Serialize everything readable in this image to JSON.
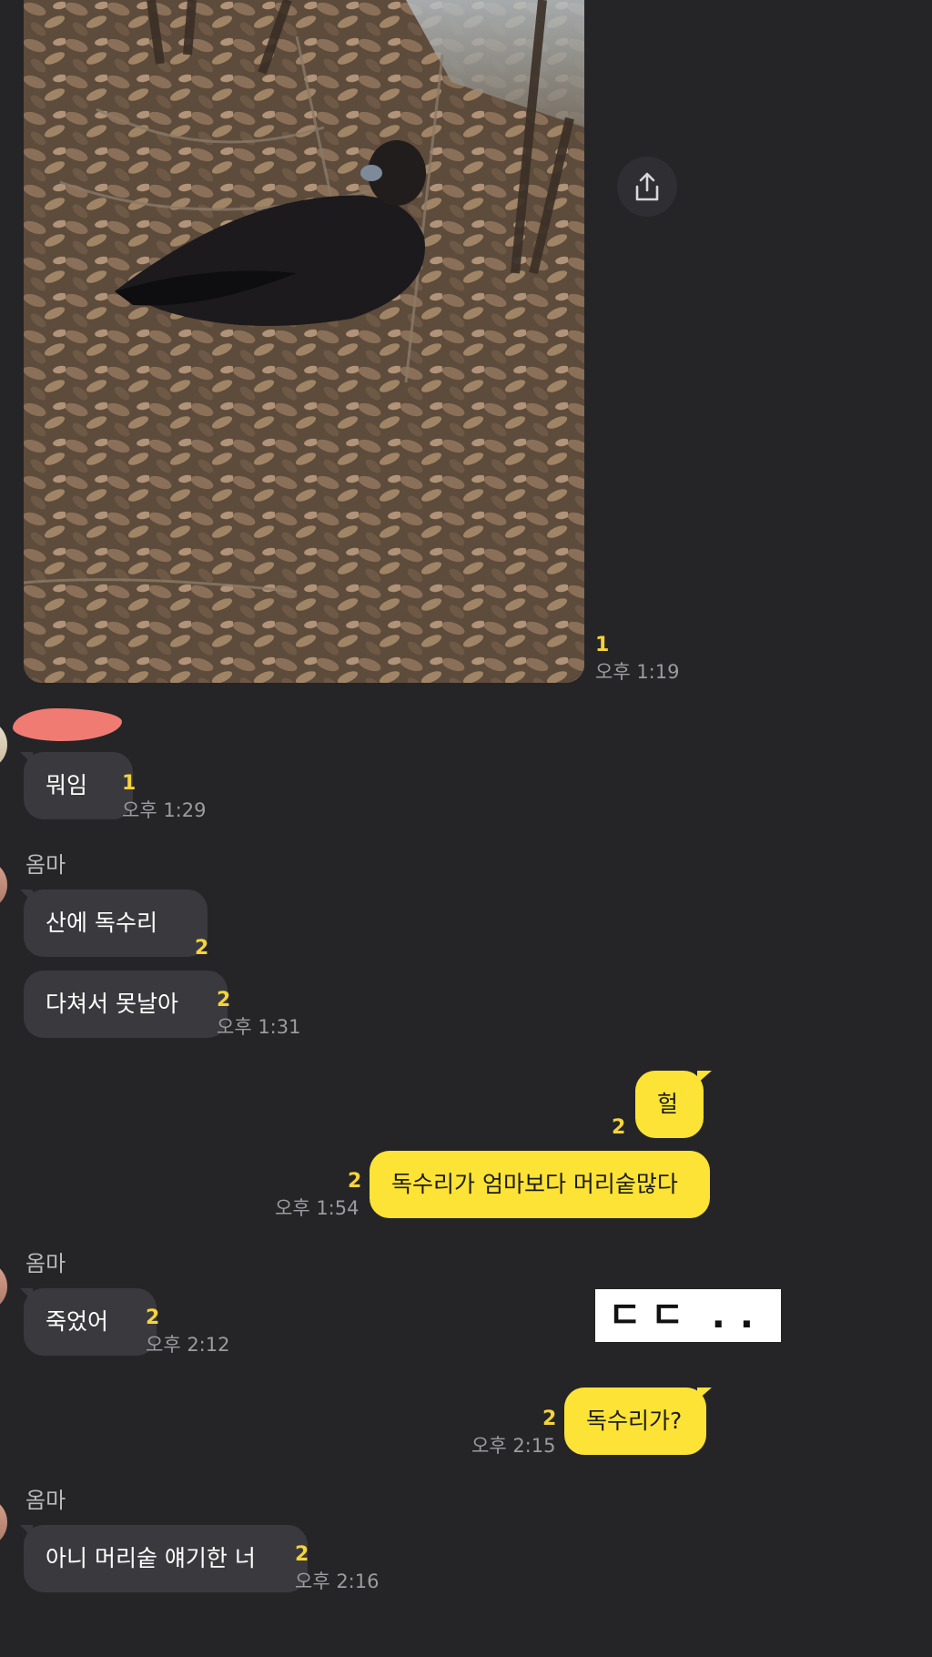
{
  "messages": {
    "photo": {
      "unread": "1",
      "time": "오후 1:19"
    },
    "m1": {
      "text": "뭐임",
      "unread": "1",
      "time": "오후 1:29"
    },
    "sender_label": "옴마",
    "m2": {
      "text": "산에 독수리",
      "unread": "2"
    },
    "m3": {
      "text": "다쳐서 못날아",
      "unread": "2",
      "time": "오후 1:31"
    },
    "m4": {
      "text": "헐",
      "unread": "2"
    },
    "m5": {
      "text": "독수리가 엄마보다 머리숱많다",
      "unread": "2",
      "time": "오후 1:54"
    },
    "m6": {
      "text": "죽었어",
      "unread": "2",
      "time": "오후 2:12"
    },
    "sticker": {
      "left": "ㄷㄷ",
      "right": ".."
    },
    "m7": {
      "text": "독수리가?",
      "unread": "2",
      "time": "오후 2:15"
    },
    "m8": {
      "text": "아니 머리숱 얘기한 너",
      "unread": "2",
      "time": "오후 2:16"
    }
  },
  "icons": {
    "share": "share-icon"
  },
  "colors": {
    "background": "#252528",
    "incoming_bubble": "#3a3a3e",
    "outgoing_bubble": "#fde335",
    "unread": "#f5d33b"
  }
}
